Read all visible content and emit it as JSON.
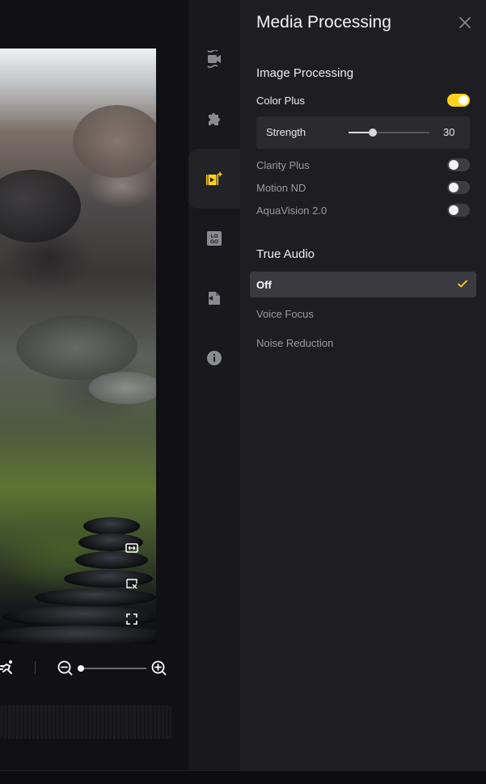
{
  "panel": {
    "title": "Media Processing",
    "image_processing": {
      "title": "Image Processing",
      "color_plus": {
        "label": "Color Plus",
        "on": true
      },
      "strength": {
        "label": "Strength",
        "value": "30",
        "fraction": 0.3
      },
      "clarity_plus": {
        "label": "Clarity Plus",
        "on": false
      },
      "motion_nd": {
        "label": "Motion ND",
        "on": false
      },
      "aquavision": {
        "label": "AquaVision 2.0",
        "on": false
      }
    },
    "true_audio": {
      "title": "True Audio",
      "options": [
        "Off",
        "Voice Focus",
        "Noise Reduction"
      ],
      "selected": "Off"
    }
  },
  "rail": {
    "items": [
      "video-stabilize-icon",
      "plugin-puzzle-icon",
      "media-processing-icon",
      "logo-icon",
      "export-file-icon",
      "info-icon"
    ],
    "active": "media-processing-icon"
  },
  "colors": {
    "accent": "#ffd21a",
    "panel_bg": "#1e1e22",
    "rail_bg": "#19191c"
  }
}
